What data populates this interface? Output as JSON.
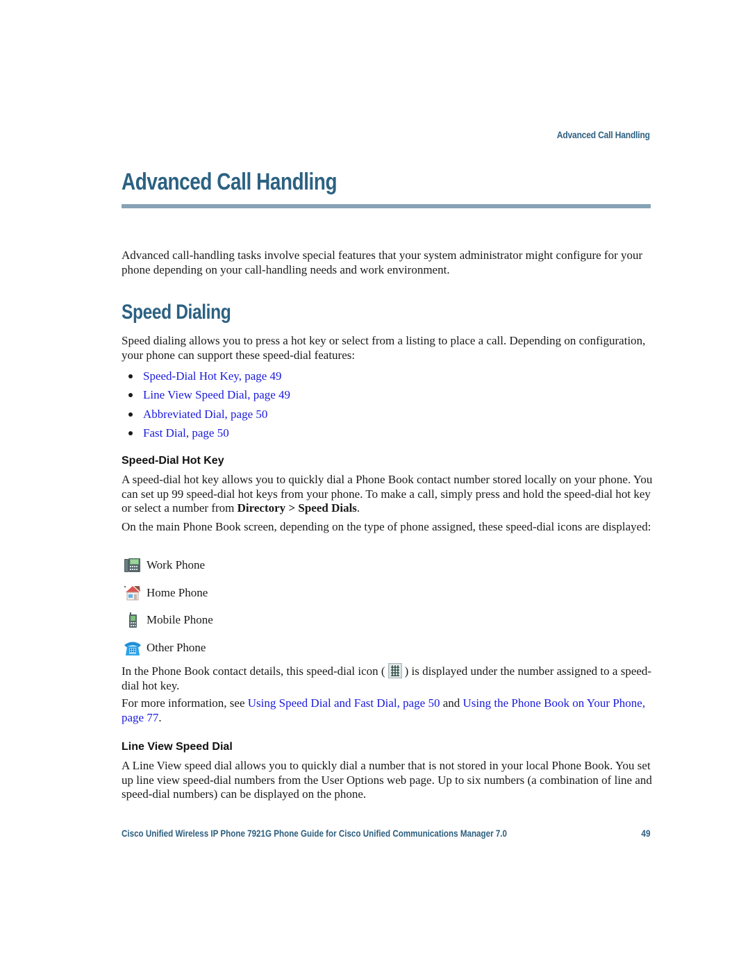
{
  "running_header": "Advanced Call Handling",
  "chapter": {
    "title": "Advanced Call Handling",
    "intro": "Advanced call-handling tasks involve special features that your system administrator might configure for your phone depending on your call-handling needs and work environment."
  },
  "speed_dialing": {
    "title": "Speed Dialing",
    "intro": "Speed dialing allows you to press a hot key or select from a listing to place a call. Depending on configuration, your phone can support these speed-dial features:",
    "links": [
      {
        "label": "Speed-Dial Hot Key, page 49"
      },
      {
        "label": "Line View Speed Dial, page 49"
      },
      {
        "label": "Abbreviated Dial, page 50"
      },
      {
        "label": "Fast Dial, page 50"
      }
    ]
  },
  "hot_key": {
    "title": "Speed-Dial Hot Key",
    "para1_text": "A speed-dial hot key allows you to quickly dial a Phone Book contact number stored locally on your phone. You can set up 99 speed-dial hot keys from your phone. To make a call, simply press and hold the speed-dial hot key or select a number from ",
    "para1_menu": "Directory",
    "para1_sep": " > ",
    "para1_submenu": "Speed Dials",
    "para1_end": ".",
    "para2": "On the main Phone Book screen, depending on the type of phone assigned, these speed-dial icons are displayed:",
    "icons": [
      {
        "icon": "work-phone-icon",
        "label": "Work Phone"
      },
      {
        "icon": "home-phone-icon",
        "label": "Home Phone"
      },
      {
        "icon": "mobile-phone-icon",
        "label": "Mobile Phone"
      },
      {
        "icon": "other-phone-icon",
        "label": "Other Phone"
      }
    ],
    "para3_before": "In the Phone Book contact details, this speed-dial icon (",
    "para3_icon": "speed-dial-keypad-icon",
    "para3_after": ") is displayed under the number assigned to a speed-dial hot key.",
    "para4_before": "For more information, see ",
    "para4_link1": "Using Speed Dial and Fast Dial, page 50",
    "para4_mid": " and ",
    "para4_link2": "Using the Phone Book on Your Phone, page 77",
    "para4_end": "."
  },
  "line_view": {
    "title": "Line View Speed Dial",
    "para": "A Line View speed dial allows you to quickly dial a number that is not stored in your local Phone Book. You set up line view speed-dial numbers from the User Options web page. Up to six numbers (a combination of line and speed-dial numbers) can be displayed on the phone."
  },
  "footer": {
    "title": "Cisco Unified Wireless IP Phone 7921G Phone Guide for Cisco Unified Communications Manager 7.0",
    "page_number": "49"
  },
  "colors": {
    "heading": "#2c6182",
    "rule": "#87a2b5",
    "link": "#1a1adb",
    "text": "#1a1a1a"
  }
}
